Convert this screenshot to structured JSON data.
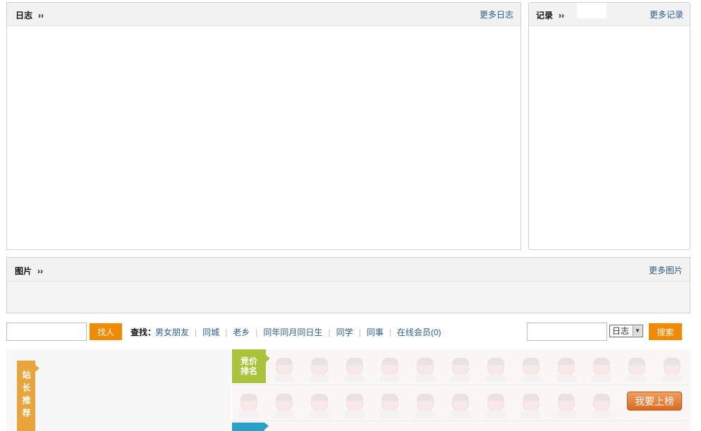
{
  "blog_panel": {
    "title": "日志",
    "chevron": "››",
    "more_link": "更多日志"
  },
  "record_panel": {
    "title": "记录",
    "chevron": "››",
    "more_link": "更多记录"
  },
  "photo_panel": {
    "title": "图片",
    "chevron": "››",
    "more_link": "更多图片"
  },
  "people_search": {
    "input_value": "",
    "button_label": "找人",
    "find_label": "查找：",
    "links": [
      "男女朋友",
      "同城",
      "老乡",
      "同年同月同日生",
      "同学",
      "同事",
      "在线会员(0)"
    ]
  },
  "site_search": {
    "input_value": "",
    "select_value": "日志",
    "button_label": "搜索"
  },
  "recommend": {
    "badge": "站长推荐"
  },
  "ranking": {
    "tag": "竞价排名",
    "button_label": "我要上榜"
  },
  "colors": {
    "accent_orange": "#f08a00",
    "link_blue": "#2a5c8a",
    "rank_green": "#a9c43a",
    "recommend_gold": "#e8a53c",
    "rank_blue": "#2a9fc8"
  }
}
